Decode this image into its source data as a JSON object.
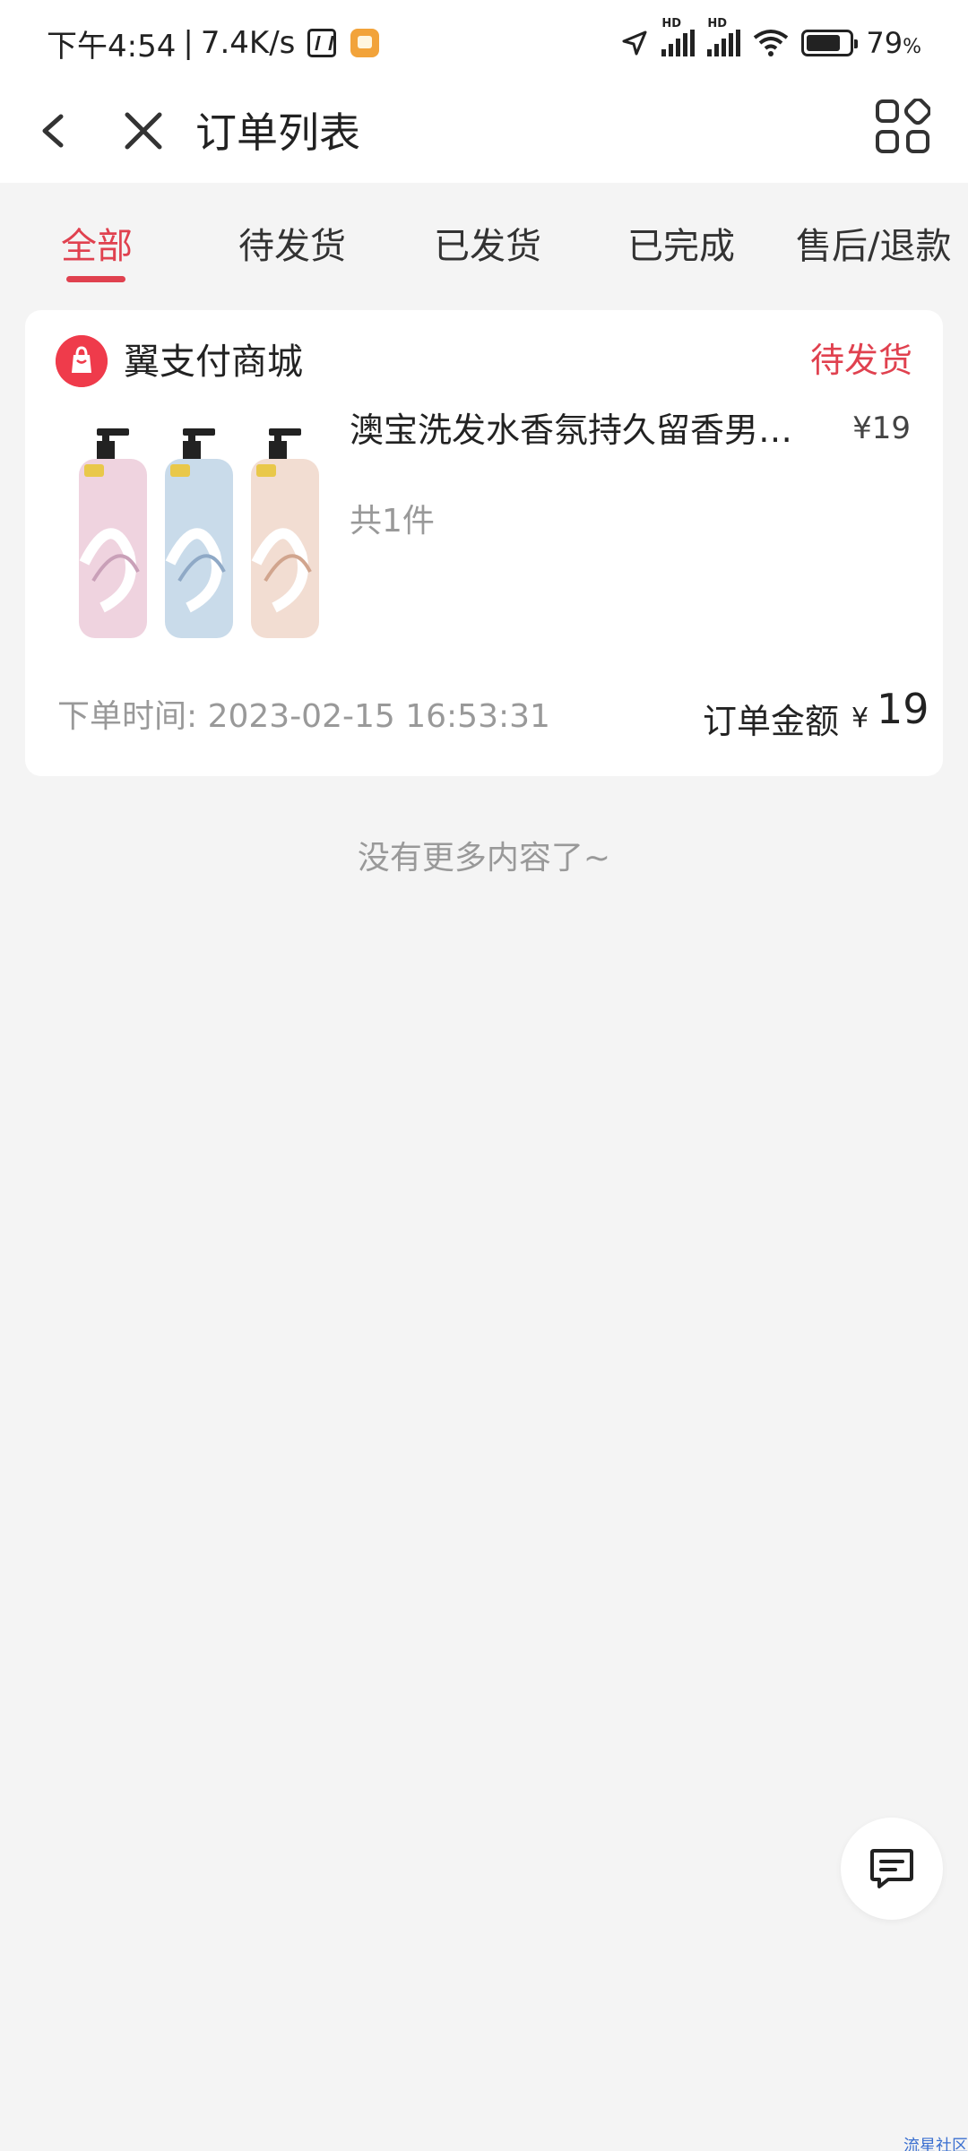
{
  "status_bar": {
    "time": "下午4:54",
    "separator": "|",
    "speed": "7.4K/s",
    "battery_percent": "79",
    "battery_unit": "%",
    "battery_level": 0.79,
    "signal_label": "HD"
  },
  "nav": {
    "title": "订单列表",
    "icons": [
      "back-icon",
      "close-icon",
      "more-grid-icon"
    ]
  },
  "tabs": [
    {
      "label": "全部",
      "active": true
    },
    {
      "label": "待发货",
      "active": false
    },
    {
      "label": "已发货",
      "active": false
    },
    {
      "label": "已完成",
      "active": false
    },
    {
      "label": "售后/退款",
      "active": false
    }
  ],
  "order": {
    "store_name": "翼支付商城",
    "status": "待发货",
    "product_title": "澳宝洗发水香氛持久留香男女…",
    "product_price": "¥19",
    "quantity_text": "共1件",
    "order_time": "下单时间: 2023-02-15 16:53:31",
    "total_label": "订单金额",
    "total_currency": "¥",
    "total_value": "19"
  },
  "footer_text": "没有更多内容了~",
  "watermark": "流星社区",
  "colors": {
    "accent": "#e0414f",
    "background": "#f4f4f4",
    "card": "#ffffff",
    "muted_text": "#999999"
  }
}
